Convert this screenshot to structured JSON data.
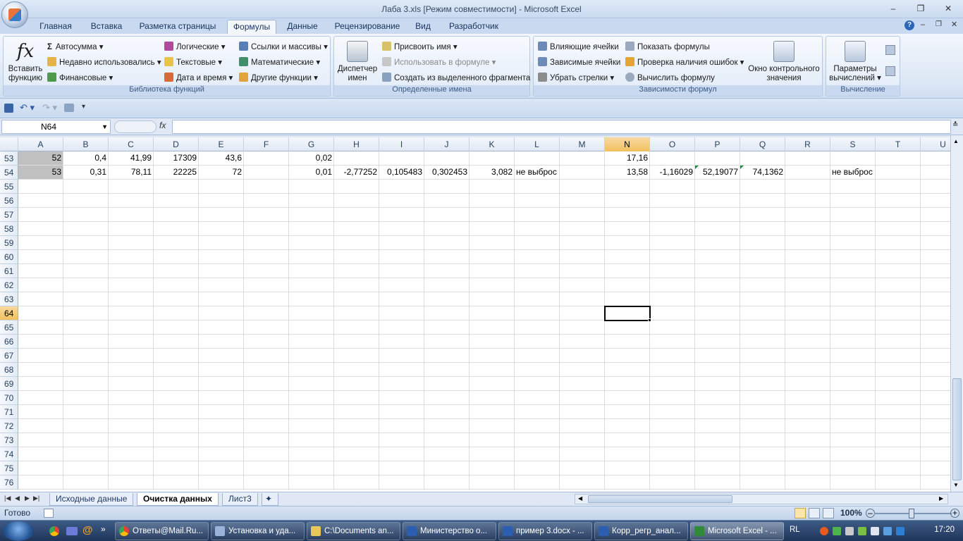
{
  "window": {
    "title": "Лаба 3.xls  [Режим совместимости] - Microsoft Excel"
  },
  "tabs": [
    "Главная",
    "Вставка",
    "Разметка страницы",
    "Формулы",
    "Данные",
    "Рецензирование",
    "Вид",
    "Разработчик"
  ],
  "ribbon": {
    "insert_function": "Вставить функцию",
    "autosum": "Автосумма",
    "recent": "Недавно использовались",
    "financial": "Финансовые",
    "logical": "Логические",
    "text": "Текстовые",
    "datetime": "Дата и время",
    "lookup": "Ссылки и массивы",
    "math": "Математические",
    "other": "Другие функции",
    "lib_label": "Библиотека функций",
    "name_manager": "Диспетчер имен",
    "define_name": "Присвоить имя",
    "use_in_formula": "Использовать в формуле",
    "create_from_sel": "Создать из выделенного фрагмента",
    "names_label": "Определенные имена",
    "trace_prec": "Влияющие ячейки",
    "trace_dep": "Зависимые ячейки",
    "remove_arrows": "Убрать стрелки",
    "show_formulas": "Показать формулы",
    "error_check": "Проверка наличия ошибок",
    "evaluate": "Вычислить формулу",
    "watch_window": "Окно контрольного значения",
    "audit_label": "Зависимости формул",
    "calc_options": "Параметры вычислений",
    "calc_label": "Вычисление"
  },
  "formula_bar": {
    "name_box": "N64",
    "fx": "fx",
    "content": ""
  },
  "columns": [
    "A",
    "B",
    "C",
    "D",
    "E",
    "F",
    "G",
    "H",
    "I",
    "J",
    "K",
    "L",
    "M",
    "N",
    "O",
    "P",
    "Q",
    "R",
    "S",
    "T",
    "U"
  ],
  "rows": [
    "53",
    "54",
    "55",
    "56",
    "57",
    "58",
    "59",
    "60",
    "61",
    "62",
    "63",
    "64",
    "65",
    "66",
    "67",
    "68",
    "69",
    "70",
    "71",
    "72",
    "73",
    "74",
    "75",
    "76"
  ],
  "cells": {
    "r53": {
      "A": "52",
      "B": "0,4",
      "C": "41,99",
      "D": "17309",
      "E": "43,6",
      "G": "0,02",
      "N": "17,16"
    },
    "r54": {
      "A": "53",
      "B": "0,31",
      "C": "78,11",
      "D": "22225",
      "E": "72",
      "G": "0,01",
      "H": "-2,77252",
      "I": "0,105483",
      "J": "0,302453",
      "K": "3,082",
      "L": "не выброс",
      "N": "13,58",
      "O": "-1,16029",
      "P": "52,19077",
      "Q": "74,1362",
      "S": "не выброс"
    }
  },
  "selected_cell": "N64",
  "sheets": [
    "Исходные данные",
    "Очистка данных",
    "Лист3"
  ],
  "status": {
    "ready": "Готово",
    "zoom": "100%"
  },
  "taskbar": {
    "items": [
      "Ответы@Mail.Ru...",
      "Установка и уда...",
      "C:\\Documents an...",
      "Министерство о...",
      "пример 3.docx - ...",
      "Корр_регр_анал...",
      "Microsoft Excel - ..."
    ],
    "lang": "RL",
    "clock": "17:20"
  }
}
